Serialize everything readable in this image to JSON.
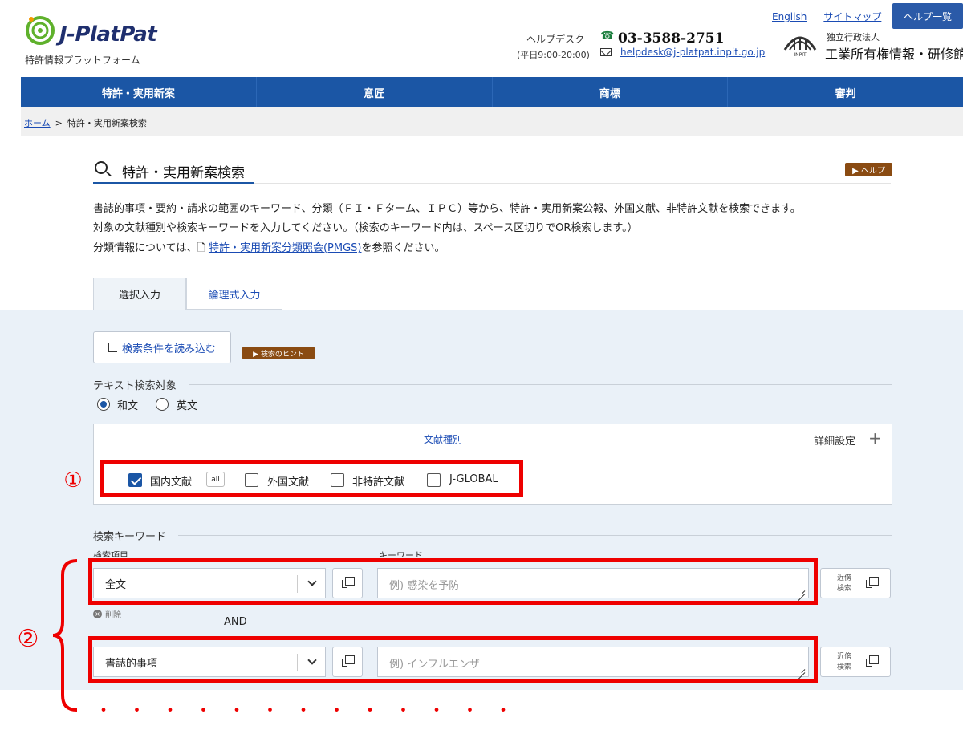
{
  "header": {
    "logo_text": "J-PlatPat",
    "logo_subtitle": "特許情報プラットフォーム",
    "top_links": [
      "English",
      "サイトマップ"
    ],
    "help_list_button": "ヘルプ一覧",
    "helpdesk_label": "ヘルプデスク",
    "helpdesk_hours": "(平日9:00-20:00)",
    "phone": "03-3588-2751",
    "email": "helpdesk@j-platpat.inpit.go.jp",
    "org_subtitle": "独立行政法人",
    "org_name": "工業所有権情報・研修館"
  },
  "nav": [
    "特許・実用新案",
    "意匠",
    "商標",
    "審判"
  ],
  "breadcrumb": {
    "home": "ホーム",
    "separator": ">",
    "current": "特許・実用新案検索"
  },
  "page": {
    "title": "特許・実用新案検索",
    "help_badge": "▶ ヘルプ",
    "desc1": "書誌的事項・要約・請求の範囲のキーワード、分類（ＦＩ・Ｆターム、ＩＰＣ）等から、特許・実用新案公報、外国文献、非特許文献を検索できます。",
    "desc2": "対象の文献種別や検索キーワードを入力してください。（検索のキーワード内は、スペース区切りでOR検索します。）",
    "desc3_prefix": "分類情報については、",
    "desc3_link": "特許・実用新案分類照会(PMGS)",
    "desc3_suffix": "を参照ください。"
  },
  "tabs": [
    "選択入力",
    "論理式入力"
  ],
  "form": {
    "load_button": "検索条件を読み込む",
    "hint_badge": "▶ 検索のヒント",
    "text_target_label": "テキスト検索対象",
    "radio_options": [
      {
        "label": "和文",
        "selected": true
      },
      {
        "label": "英文",
        "selected": false
      }
    ],
    "doc_type_label": "文献種別",
    "detail_settings": "詳細設定",
    "doc_types": [
      {
        "label": "国内文献",
        "checked": true
      },
      {
        "label": "外国文献",
        "checked": false
      },
      {
        "label": "非特許文献",
        "checked": false
      },
      {
        "label": "J-GLOBAL",
        "checked": false
      }
    ],
    "all_tag": "all",
    "keyword_section_label": "検索キーワード",
    "search_item_label": "検索項目",
    "keyword_label": "キーワード",
    "rows": [
      {
        "field": "全文",
        "placeholder": "例) 感染を予防"
      },
      {
        "field": "書誌的事項",
        "placeholder": "例) インフルエンザ"
      }
    ],
    "delete_label": "削除",
    "and_label": "AND",
    "proximity_line1": "近傍",
    "proximity_line2": "検索"
  },
  "annotations": {
    "circle1": "①",
    "circle2": "②",
    "color": "#ee0000"
  },
  "colors": {
    "nav_bg": "#1b56a5",
    "badge_bg": "#8a4b12",
    "panel_bg": "#eaf1f8"
  }
}
